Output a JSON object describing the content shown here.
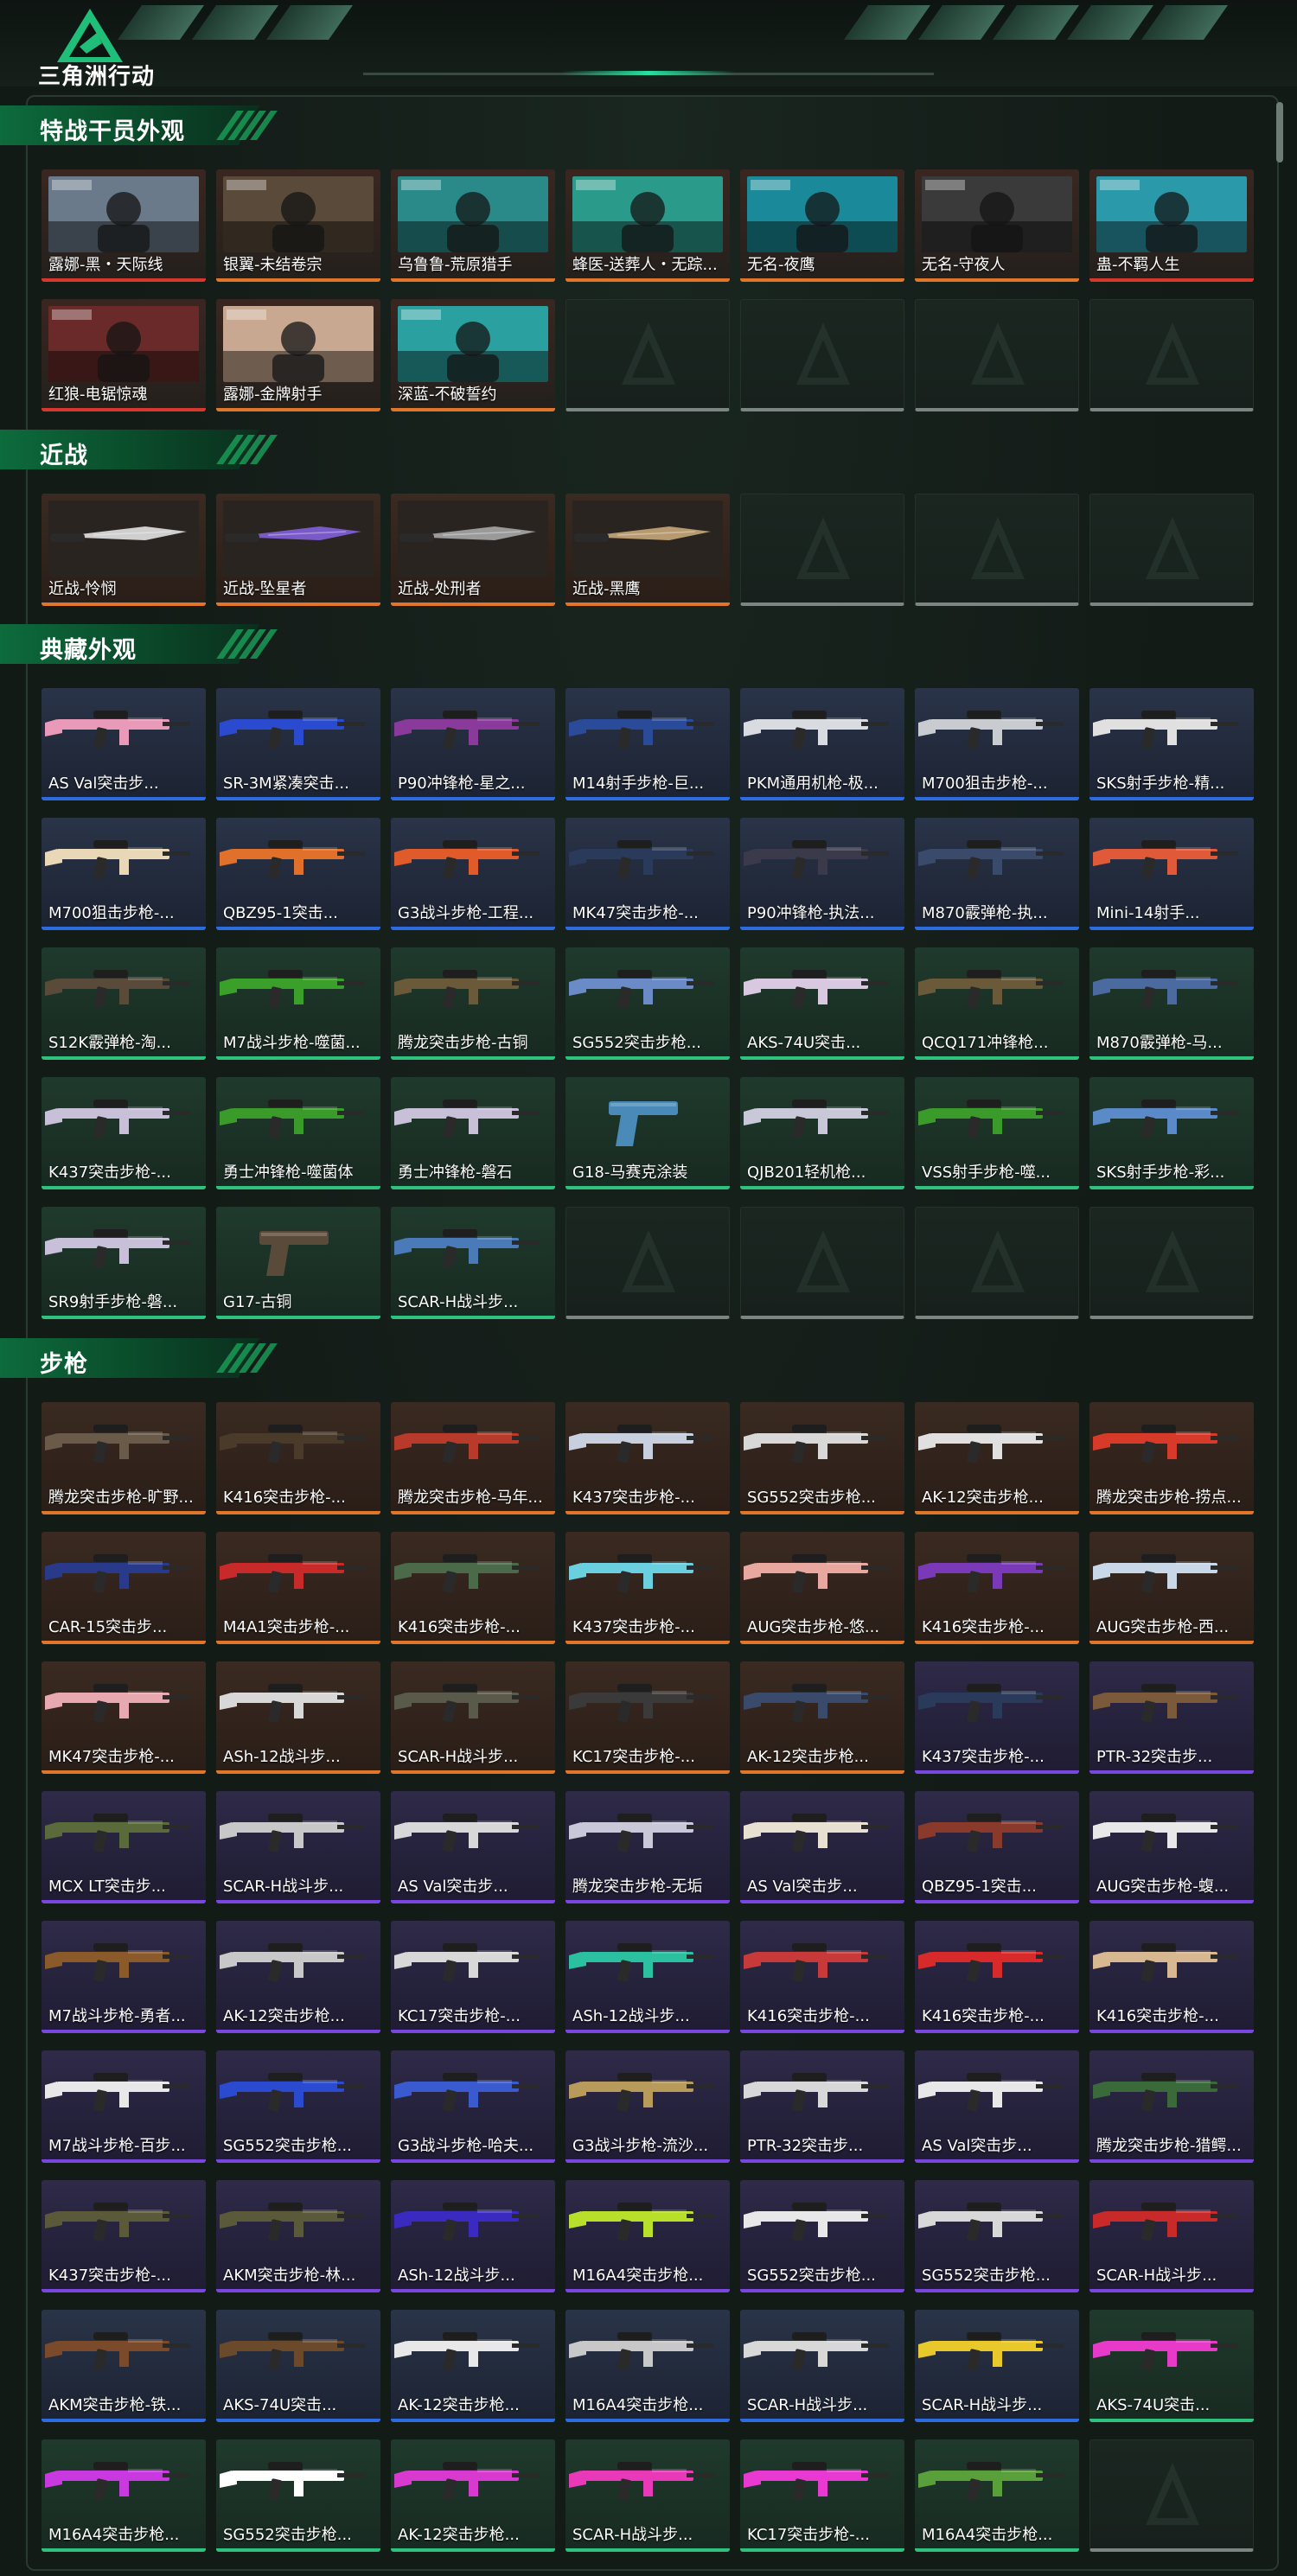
{
  "header": {
    "brand": "三角洲行动"
  },
  "sections": [
    {
      "title": "特战干员外观",
      "cards": [
        {
          "label": "露娜-黑・天际线",
          "rarity": "operator-red",
          "icon": "operator-portrait",
          "accent": "#6a7a8a"
        },
        {
          "label": "银翼-未结卷宗",
          "rarity": "operator",
          "icon": "operator-portrait",
          "accent": "#5a4a3a"
        },
        {
          "label": "乌鲁鲁-荒原猎手",
          "rarity": "operator",
          "icon": "operator-portrait",
          "accent": "#2a8a8a"
        },
        {
          "label": "蜂医-送葬人・无踪...",
          "rarity": "operator",
          "icon": "operator-portrait",
          "accent": "#2a9a8a"
        },
        {
          "label": "无名-夜鹰",
          "rarity": "operator",
          "icon": "operator-portrait",
          "accent": "#1a8a9a"
        },
        {
          "label": "无名-守夜人",
          "rarity": "operator",
          "icon": "operator-portrait",
          "accent": "#3a3a3a"
        },
        {
          "label": "蛊-不羁人生",
          "rarity": "operator-red",
          "icon": "operator-portrait",
          "accent": "#2a9aaa"
        },
        {
          "label": "红狼-电锯惊魂",
          "rarity": "operator-red",
          "icon": "operator-portrait",
          "accent": "#6a2a2a"
        },
        {
          "label": "露娜-金牌射手",
          "rarity": "operator",
          "icon": "operator-portrait",
          "accent": "#c8a890"
        },
        {
          "label": "深蓝-不破誓约",
          "rarity": "operator",
          "icon": "operator-portrait",
          "accent": "#2aa0a0"
        },
        {
          "label": "",
          "rarity": "empty"
        },
        {
          "label": "",
          "rarity": "empty"
        },
        {
          "label": "",
          "rarity": "empty"
        },
        {
          "label": "",
          "rarity": "empty"
        }
      ]
    },
    {
      "title": "近战",
      "cards": [
        {
          "label": "近战-怜悯",
          "rarity": "brown",
          "icon": "knife-icon",
          "accent": "#cfcfcf"
        },
        {
          "label": "近战-坠星者",
          "rarity": "brown",
          "icon": "knife-icon",
          "accent": "#7a5ac8"
        },
        {
          "label": "近战-处刑者",
          "rarity": "brown",
          "icon": "knife-icon",
          "accent": "#9a9a9a"
        },
        {
          "label": "近战-黑鹰",
          "rarity": "brown",
          "icon": "knife-icon",
          "accent": "#b89a70"
        },
        {
          "label": "",
          "rarity": "empty"
        },
        {
          "label": "",
          "rarity": "empty"
        },
        {
          "label": "",
          "rarity": "empty"
        }
      ]
    },
    {
      "title": "典藏外观",
      "cards": [
        {
          "label": "AS Val突击步...",
          "rarity": "blue",
          "icon": "rifle-icon",
          "accent": "#e89ab8"
        },
        {
          "label": "SR-3M紧凑突击...",
          "rarity": "blue",
          "icon": "rifle-icon",
          "accent": "#2a4ad0"
        },
        {
          "label": "P90冲锋枪-星之...",
          "rarity": "blue",
          "icon": "rifle-icon",
          "accent": "#8a3a9a"
        },
        {
          "label": "M14射手步枪-巨...",
          "rarity": "blue",
          "icon": "rifle-icon",
          "accent": "#2a4a9a"
        },
        {
          "label": "PKM通用机枪-极...",
          "rarity": "blue",
          "icon": "rifle-icon",
          "accent": "#d8dce0"
        },
        {
          "label": "M700狙击步枪-...",
          "rarity": "blue",
          "icon": "rifle-icon",
          "accent": "#c8ccd0"
        },
        {
          "label": "SKS射手步枪-精...",
          "rarity": "blue",
          "icon": "rifle-icon",
          "accent": "#e0e0e0"
        },
        {
          "label": "M700狙击步枪-...",
          "rarity": "blue",
          "icon": "rifle-icon",
          "accent": "#e8d8b8"
        },
        {
          "label": "QBZ95-1突击...",
          "rarity": "blue",
          "icon": "rifle-icon",
          "accent": "#e0702a"
        },
        {
          "label": "G3战斗步枪-工程...",
          "rarity": "blue",
          "icon": "rifle-icon",
          "accent": "#e05a2a"
        },
        {
          "label": "MK47突击步枪-...",
          "rarity": "blue",
          "icon": "rifle-icon",
          "accent": "#2a3a5a"
        },
        {
          "label": "P90冲锋枪-执法...",
          "rarity": "blue",
          "icon": "rifle-icon",
          "accent": "#3a3a4a"
        },
        {
          "label": "M870霰弹枪-执...",
          "rarity": "blue",
          "icon": "rifle-icon",
          "accent": "#3a4a6a"
        },
        {
          "label": "Mini-14射手...",
          "rarity": "blue",
          "icon": "rifle-icon",
          "accent": "#e05a3a"
        },
        {
          "label": "S12K霰弹枪-淘...",
          "rarity": "green",
          "icon": "rifle-icon",
          "accent": "#5a4a3a"
        },
        {
          "label": "M7战斗步枪-噬菌...",
          "rarity": "green",
          "icon": "rifle-icon",
          "accent": "#3aa02a"
        },
        {
          "label": "腾龙突击步枪-古铜",
          "rarity": "green",
          "icon": "rifle-icon",
          "accent": "#6a5a3a"
        },
        {
          "label": "SG552突击步枪...",
          "rarity": "green",
          "icon": "rifle-icon",
          "accent": "#6a8ac8"
        },
        {
          "label": "AKS-74U突击...",
          "rarity": "green",
          "icon": "rifle-icon",
          "accent": "#d8c8e0"
        },
        {
          "label": "QCQ171冲锋枪...",
          "rarity": "green",
          "icon": "rifle-icon",
          "accent": "#6a5a3a"
        },
        {
          "label": "M870霰弹枪-马...",
          "rarity": "green",
          "icon": "rifle-icon",
          "accent": "#4a6aa0"
        },
        {
          "label": "K437突击步枪-...",
          "rarity": "green",
          "icon": "rifle-icon",
          "accent": "#c8c0d8"
        },
        {
          "label": "勇士冲锋枪-噬菌体",
          "rarity": "green",
          "icon": "rifle-icon",
          "accent": "#3a9a2a"
        },
        {
          "label": "勇士冲锋枪-磐石",
          "rarity": "green",
          "icon": "rifle-icon",
          "accent": "#c8c0d8"
        },
        {
          "label": "G18-马赛克涂装",
          "rarity": "green",
          "icon": "pistol-icon",
          "accent": "#4a8ab8"
        },
        {
          "label": "QJB201轻机枪...",
          "rarity": "green",
          "icon": "rifle-icon",
          "accent": "#c8c8d8"
        },
        {
          "label": "VSS射手步枪-噬...",
          "rarity": "green",
          "icon": "rifle-icon",
          "accent": "#3a9a2a"
        },
        {
          "label": "SKS射手步枪-彩...",
          "rarity": "green",
          "icon": "rifle-icon",
          "accent": "#5a8ac8"
        },
        {
          "label": "SR9射手步枪-磐...",
          "rarity": "green",
          "icon": "rifle-icon",
          "accent": "#c8c0d8"
        },
        {
          "label": "G17-古铜",
          "rarity": "green",
          "icon": "pistol-icon",
          "accent": "#5a4a3a"
        },
        {
          "label": "SCAR-H战斗步...",
          "rarity": "green",
          "icon": "rifle-icon",
          "accent": "#4a7ab8"
        },
        {
          "label": "",
          "rarity": "empty"
        },
        {
          "label": "",
          "rarity": "empty"
        },
        {
          "label": "",
          "rarity": "empty"
        },
        {
          "label": "",
          "rarity": "empty"
        }
      ]
    },
    {
      "title": "步枪",
      "cards": [
        {
          "label": "腾龙突击步枪-旷野...",
          "rarity": "brown",
          "icon": "rifle-icon",
          "accent": "#6a5a4a"
        },
        {
          "label": "K416突击步枪-...",
          "rarity": "brown",
          "icon": "rifle-icon",
          "accent": "#4a3a2a"
        },
        {
          "label": "腾龙突击步枪-马年...",
          "rarity": "brown",
          "icon": "rifle-icon",
          "accent": "#b83a2a"
        },
        {
          "label": "K437突击步枪-...",
          "rarity": "brown",
          "icon": "rifle-icon",
          "accent": "#c8d0e0"
        },
        {
          "label": "SG552突击步枪...",
          "rarity": "brown",
          "icon": "rifle-icon",
          "accent": "#d8d8d8"
        },
        {
          "label": "AK-12突击步枪...",
          "rarity": "brown",
          "icon": "rifle-icon",
          "accent": "#e0e0e0"
        },
        {
          "label": "腾龙突击步枪-捞点...",
          "rarity": "brown",
          "icon": "rifle-icon",
          "accent": "#d83a2a"
        },
        {
          "label": "CAR-15突击步...",
          "rarity": "brown",
          "icon": "rifle-icon",
          "accent": "#2a3a8a"
        },
        {
          "label": "M4A1突击步枪-...",
          "rarity": "brown",
          "icon": "rifle-icon",
          "accent": "#c82a2a"
        },
        {
          "label": "K416突击步枪-...",
          "rarity": "brown",
          "icon": "rifle-icon",
          "accent": "#4a6a4a"
        },
        {
          "label": "K437突击步枪-...",
          "rarity": "brown",
          "icon": "rifle-icon",
          "accent": "#6ad0e0"
        },
        {
          "label": "AUG突击步枪-悠...",
          "rarity": "brown",
          "icon": "rifle-icon",
          "accent": "#e8a8a0"
        },
        {
          "label": "K416突击步枪-...",
          "rarity": "brown",
          "icon": "rifle-icon",
          "accent": "#7a3ab8"
        },
        {
          "label": "AUG突击步枪-西...",
          "rarity": "brown",
          "icon": "rifle-icon",
          "accent": "#c8d8e8"
        },
        {
          "label": "MK47突击步枪-...",
          "rarity": "brown",
          "icon": "rifle-icon",
          "accent": "#e8a8b0"
        },
        {
          "label": "ASh-12战斗步...",
          "rarity": "brown",
          "icon": "rifle-icon",
          "accent": "#d8d8d8"
        },
        {
          "label": "SCAR-H战斗步...",
          "rarity": "brown",
          "icon": "rifle-icon",
          "accent": "#5a5a4a"
        },
        {
          "label": "KC17突击步枪-...",
          "rarity": "brown",
          "icon": "rifle-icon",
          "accent": "#3a3a3a"
        },
        {
          "label": "AK-12突击步枪...",
          "rarity": "brown",
          "icon": "rifle-icon",
          "accent": "#3a4a6a"
        },
        {
          "label": "K437突击步枪-...",
          "rarity": "purple",
          "icon": "rifle-icon",
          "accent": "#2a3a5a"
        },
        {
          "label": "PTR-32突击步...",
          "rarity": "purple",
          "icon": "rifle-icon",
          "accent": "#7a5a3a"
        },
        {
          "label": "MCX LT突击步...",
          "rarity": "purple",
          "icon": "rifle-icon",
          "accent": "#5a6a3a"
        },
        {
          "label": "SCAR-H战斗步...",
          "rarity": "purple",
          "icon": "rifle-icon",
          "accent": "#c8c8c8"
        },
        {
          "label": "AS Val突击步...",
          "rarity": "purple",
          "icon": "rifle-icon",
          "accent": "#d8d8d8"
        },
        {
          "label": "腾龙突击步枪-无垢",
          "rarity": "purple",
          "icon": "rifle-icon",
          "accent": "#c8c8d8"
        },
        {
          "label": "AS Val突击步...",
          "rarity": "purple",
          "icon": "rifle-icon",
          "accent": "#e8e0d0"
        },
        {
          "label": "QBZ95-1突击...",
          "rarity": "purple",
          "icon": "rifle-icon",
          "accent": "#8a3a2a"
        },
        {
          "label": "AUG突击步枪-蝮...",
          "rarity": "purple",
          "icon": "rifle-icon",
          "accent": "#e8e8e8"
        },
        {
          "label": "M7战斗步枪-勇者...",
          "rarity": "purple",
          "icon": "rifle-icon",
          "accent": "#8a5a2a"
        },
        {
          "label": "AK-12突击步枪...",
          "rarity": "purple",
          "icon": "rifle-icon",
          "accent": "#c8c8c8"
        },
        {
          "label": "KC17突击步枪-...",
          "rarity": "purple",
          "icon": "rifle-icon",
          "accent": "#d8d8d8"
        },
        {
          "label": "ASh-12战斗步...",
          "rarity": "purple",
          "icon": "rifle-icon",
          "accent": "#2ac0a0"
        },
        {
          "label": "K416突击步枪-...",
          "rarity": "purple",
          "icon": "rifle-icon",
          "accent": "#c83a3a"
        },
        {
          "label": "K416突击步枪-...",
          "rarity": "purple",
          "icon": "rifle-icon",
          "accent": "#d82a2a"
        },
        {
          "label": "K416突击步枪-...",
          "rarity": "purple",
          "icon": "rifle-icon",
          "accent": "#d8b890"
        },
        {
          "label": "M7战斗步枪-百步...",
          "rarity": "purple",
          "icon": "rifle-icon",
          "accent": "#e8e8e8"
        },
        {
          "label": "SG552突击步枪...",
          "rarity": "purple",
          "icon": "rifle-icon",
          "accent": "#2a4ad0"
        },
        {
          "label": "G3战斗步枪-哈夫...",
          "rarity": "purple",
          "icon": "rifle-icon",
          "accent": "#3a5ad0"
        },
        {
          "label": "G3战斗步枪-流沙...",
          "rarity": "purple",
          "icon": "rifle-icon",
          "accent": "#b89a5a"
        },
        {
          "label": "PTR-32突击步...",
          "rarity": "purple",
          "icon": "rifle-icon",
          "accent": "#d8d8d8"
        },
        {
          "label": "AS Val突击步...",
          "rarity": "purple",
          "icon": "rifle-icon",
          "accent": "#e8e8e8"
        },
        {
          "label": "腾龙突击步枪-猎鳄...",
          "rarity": "purple",
          "icon": "rifle-icon",
          "accent": "#3a6a3a"
        },
        {
          "label": "K437突击步枪-...",
          "rarity": "purple",
          "icon": "rifle-icon",
          "accent": "#5a5a3a"
        },
        {
          "label": "AKM突击步枪-林...",
          "rarity": "purple",
          "icon": "rifle-icon",
          "accent": "#5a5a3a"
        },
        {
          "label": "ASh-12战斗步...",
          "rarity": "purple",
          "icon": "rifle-icon",
          "accent": "#3a2ac0"
        },
        {
          "label": "M16A4突击步枪...",
          "rarity": "purple",
          "icon": "rifle-icon",
          "accent": "#b8e02a"
        },
        {
          "label": "SG552突击步枪...",
          "rarity": "purple",
          "icon": "rifle-icon",
          "accent": "#e8e8e8"
        },
        {
          "label": "SG552突击步枪...",
          "rarity": "purple",
          "icon": "rifle-icon",
          "accent": "#d8d8d8"
        },
        {
          "label": "SCAR-H战斗步...",
          "rarity": "purple",
          "icon": "rifle-icon",
          "accent": "#c82a2a"
        },
        {
          "label": "AKM突击步枪-铁...",
          "rarity": "blue",
          "icon": "rifle-icon",
          "accent": "#7a4a2a"
        },
        {
          "label": "AKS-74U突击...",
          "rarity": "blue",
          "icon": "rifle-icon",
          "accent": "#6a4a2a"
        },
        {
          "label": "AK-12突击步枪...",
          "rarity": "blue",
          "icon": "rifle-icon",
          "accent": "#e8e8e8"
        },
        {
          "label": "M16A4突击步枪...",
          "rarity": "blue",
          "icon": "rifle-icon",
          "accent": "#c8c8c8"
        },
        {
          "label": "SCAR-H战斗步...",
          "rarity": "blue",
          "icon": "rifle-icon",
          "accent": "#d8d8d8"
        },
        {
          "label": "SCAR-H战斗步...",
          "rarity": "blue",
          "icon": "rifle-icon",
          "accent": "#e8c82a"
        },
        {
          "label": "AKS-74U突击...",
          "rarity": "green",
          "icon": "rifle-icon",
          "accent": "#e83ac8"
        },
        {
          "label": "M16A4突击步枪...",
          "rarity": "green",
          "icon": "rifle-icon",
          "accent": "#c83ae0"
        },
        {
          "label": "SG552突击步枪...",
          "rarity": "green",
          "icon": "rifle-icon",
          "accent": "#ffffff"
        },
        {
          "label": "AK-12突击步枪...",
          "rarity": "green",
          "icon": "rifle-icon",
          "accent": "#d83ad0"
        },
        {
          "label": "SCAR-H战斗步...",
          "rarity": "green",
          "icon": "rifle-icon",
          "accent": "#e83ab8"
        },
        {
          "label": "KC17突击步枪-...",
          "rarity": "green",
          "icon": "rifle-icon",
          "accent": "#e83ad0"
        },
        {
          "label": "M16A4突击步枪...",
          "rarity": "green",
          "icon": "rifle-icon",
          "accent": "#5aa03a"
        },
        {
          "label": "",
          "rarity": "empty"
        }
      ]
    }
  ]
}
